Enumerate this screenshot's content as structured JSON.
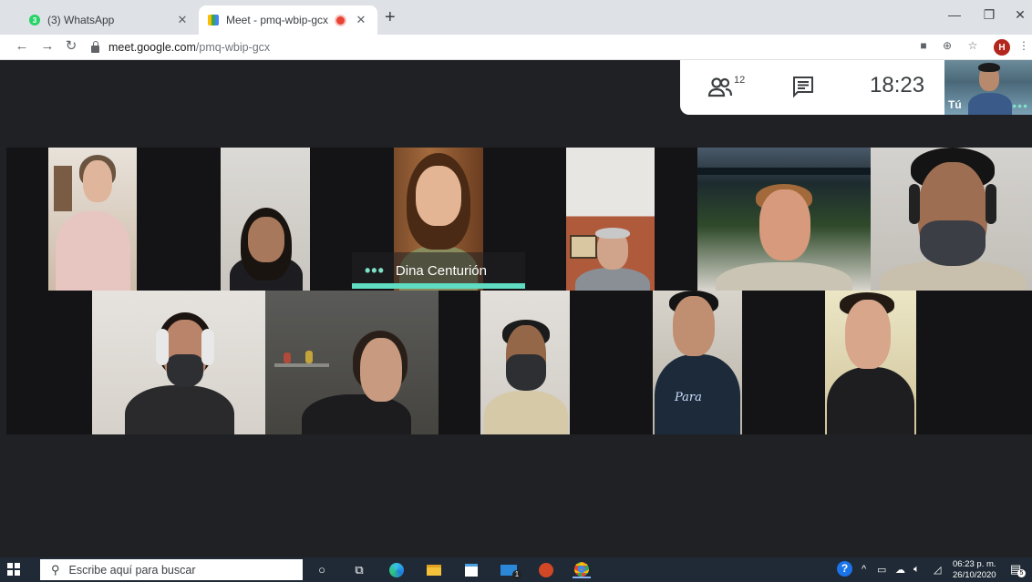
{
  "browser": {
    "tabs": [
      {
        "title": "(3) WhatsApp",
        "favicon_badge": "3",
        "active": false
      },
      {
        "title": "Meet - pmq-wbip-gcx",
        "active": true
      }
    ],
    "new_tab_label": "+",
    "url_domain": "meet.google.com",
    "url_path": "/pmq-wbip-gcx",
    "profile_initial": "H",
    "accent": "#1a73e8"
  },
  "meet": {
    "participant_count": "12",
    "clock": "18:23",
    "self_label": "Tú",
    "active_speaker": "Dina Centurión",
    "speaker_color": "#5fdcc1"
  },
  "taskbar": {
    "search_placeholder": "Escribe aquí para buscar",
    "time": "06:23 p. m.",
    "date": "26/10/2020",
    "notification_count": "5",
    "mail_badge": "1"
  }
}
